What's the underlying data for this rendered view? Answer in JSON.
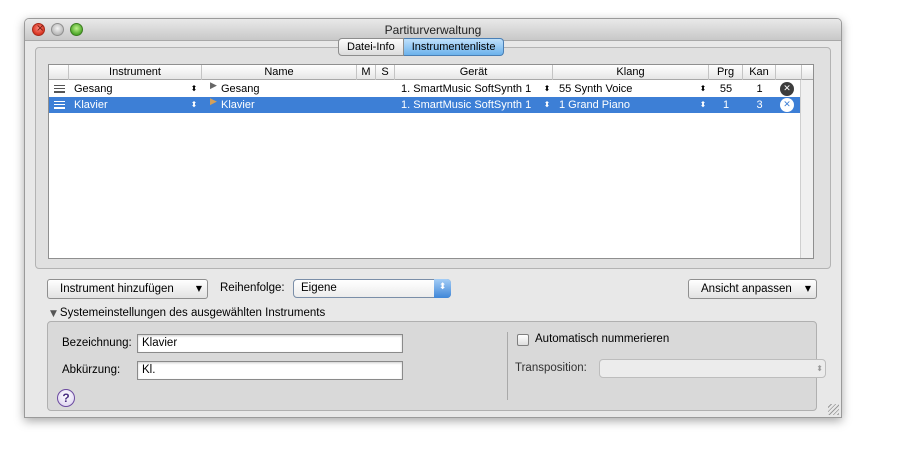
{
  "window": {
    "title": "Partiturverwaltung"
  },
  "tabs": [
    {
      "label": "Datei-Info",
      "active": false
    },
    {
      "label": "Instrumentenliste",
      "active": true
    }
  ],
  "table": {
    "columns": [
      "Instrument",
      "Name",
      "M",
      "S",
      "Gerät",
      "Klang",
      "Prg",
      "Kan"
    ],
    "rows": [
      {
        "instrument": "Gesang",
        "name": "Gesang",
        "device": "1. SmartMusic SoftSynth 1",
        "sound": "55 Synth Voice",
        "prg": "55",
        "kan": "1",
        "selected": false
      },
      {
        "instrument": "Klavier",
        "name": "Klavier",
        "device": "1. SmartMusic SoftSynth 1",
        "sound": "1 Grand Piano",
        "prg": "1",
        "kan": "3",
        "selected": true
      }
    ]
  },
  "controls": {
    "add_instrument": "Instrument hinzufügen",
    "order_label": "Reihenfolge:",
    "order_value": "Eigene",
    "adjust_view": "Ansicht anpassen"
  },
  "settings": {
    "section_title": "Systemeinstellungen des ausgewählten Instruments",
    "designation_label": "Bezeichnung:",
    "designation_value": "Klavier",
    "abbreviation_label": "Abkürzung:",
    "abbreviation_value": "Kl.",
    "auto_number_label": "Automatisch nummerieren",
    "auto_number_checked": false,
    "transposition_label": "Transposition:",
    "transposition_value": ""
  },
  "help": {
    "label": "?"
  },
  "colors": {
    "selection": "#3d7fd6",
    "accent": "#6cb2ec"
  }
}
